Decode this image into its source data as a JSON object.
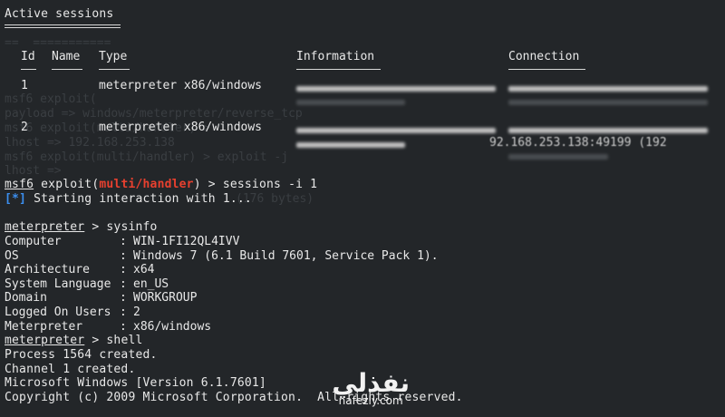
{
  "table": {
    "title": "Active sessions",
    "columns": [
      "Id",
      "Name",
      "Type",
      "Information",
      "Connection"
    ],
    "rows": [
      {
        "id": "1",
        "name": "",
        "type": "meterpreter x86/windows"
      },
      {
        "id": "2",
        "name": "",
        "type": "meterpreter x86/windows"
      }
    ]
  },
  "command": {
    "prompt_user": "msf6",
    "prompt_mid": " exploit(",
    "module": "multi/handler",
    "prompt_end": ") > ",
    "input": "sessions -i 1"
  },
  "status": {
    "marker": "[*]",
    "text": " Starting interaction with 1..."
  },
  "meterpreter": {
    "prompt": "meterpreter",
    "prompt_sep": " > ",
    "cmd1": "sysinfo",
    "cmd2": "shell"
  },
  "sysinfo": [
    {
      "key": "Computer",
      "value": "WIN-1FI12QL4IVV"
    },
    {
      "key": "OS",
      "value": "Windows 7 (6.1 Build 7601, Service Pack 1)."
    },
    {
      "key": "Architecture",
      "value": "x64"
    },
    {
      "key": "System Language",
      "value": "en_US"
    },
    {
      "key": "Domain",
      "value": "WORKGROUP"
    },
    {
      "key": "Logged On Users",
      "value": "2"
    },
    {
      "key": "Meterpreter",
      "value": "x86/windows"
    }
  ],
  "shell_output": [
    "Process 1564 created.",
    "Channel 1 created.",
    "Microsoft Windows [Version 6.1.7601]",
    "Copyright (c) 2009 Microsoft Corporation.  All rights reserved."
  ],
  "partial_visible": {
    "connection_row2": "92.168.253.138:49199 (192"
  },
  "watermark": {
    "arabic": "نفذلي",
    "latin": "nafezly.com"
  },
  "colors": {
    "background": "#232629",
    "text": "#e8e8e8",
    "module_red": "#e8402f",
    "marker_blue": "#3b8ff0"
  }
}
